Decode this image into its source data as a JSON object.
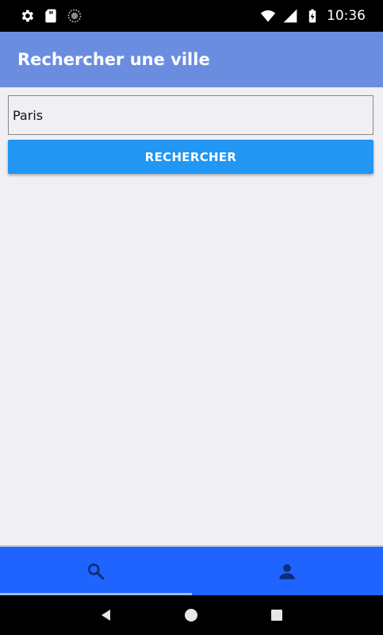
{
  "status_bar": {
    "time": "10:36",
    "left_icons": [
      "gear-icon",
      "sd-card-icon",
      "sync-icon"
    ],
    "right_icons": [
      "wifi-icon",
      "signal-icon",
      "battery-icon"
    ]
  },
  "app_bar": {
    "title": "Rechercher une ville",
    "color": "#6a8de0"
  },
  "search": {
    "value": "Paris",
    "button_label": "RECHERCHER",
    "button_color": "#2196f3"
  },
  "tabs": [
    {
      "icon": "search-icon",
      "selected": true
    },
    {
      "icon": "user-icon",
      "selected": false
    }
  ],
  "tab_bar_color": "#1f64ff",
  "nav_bar": {
    "buttons": [
      "back-icon",
      "home-icon",
      "recents-icon"
    ]
  }
}
